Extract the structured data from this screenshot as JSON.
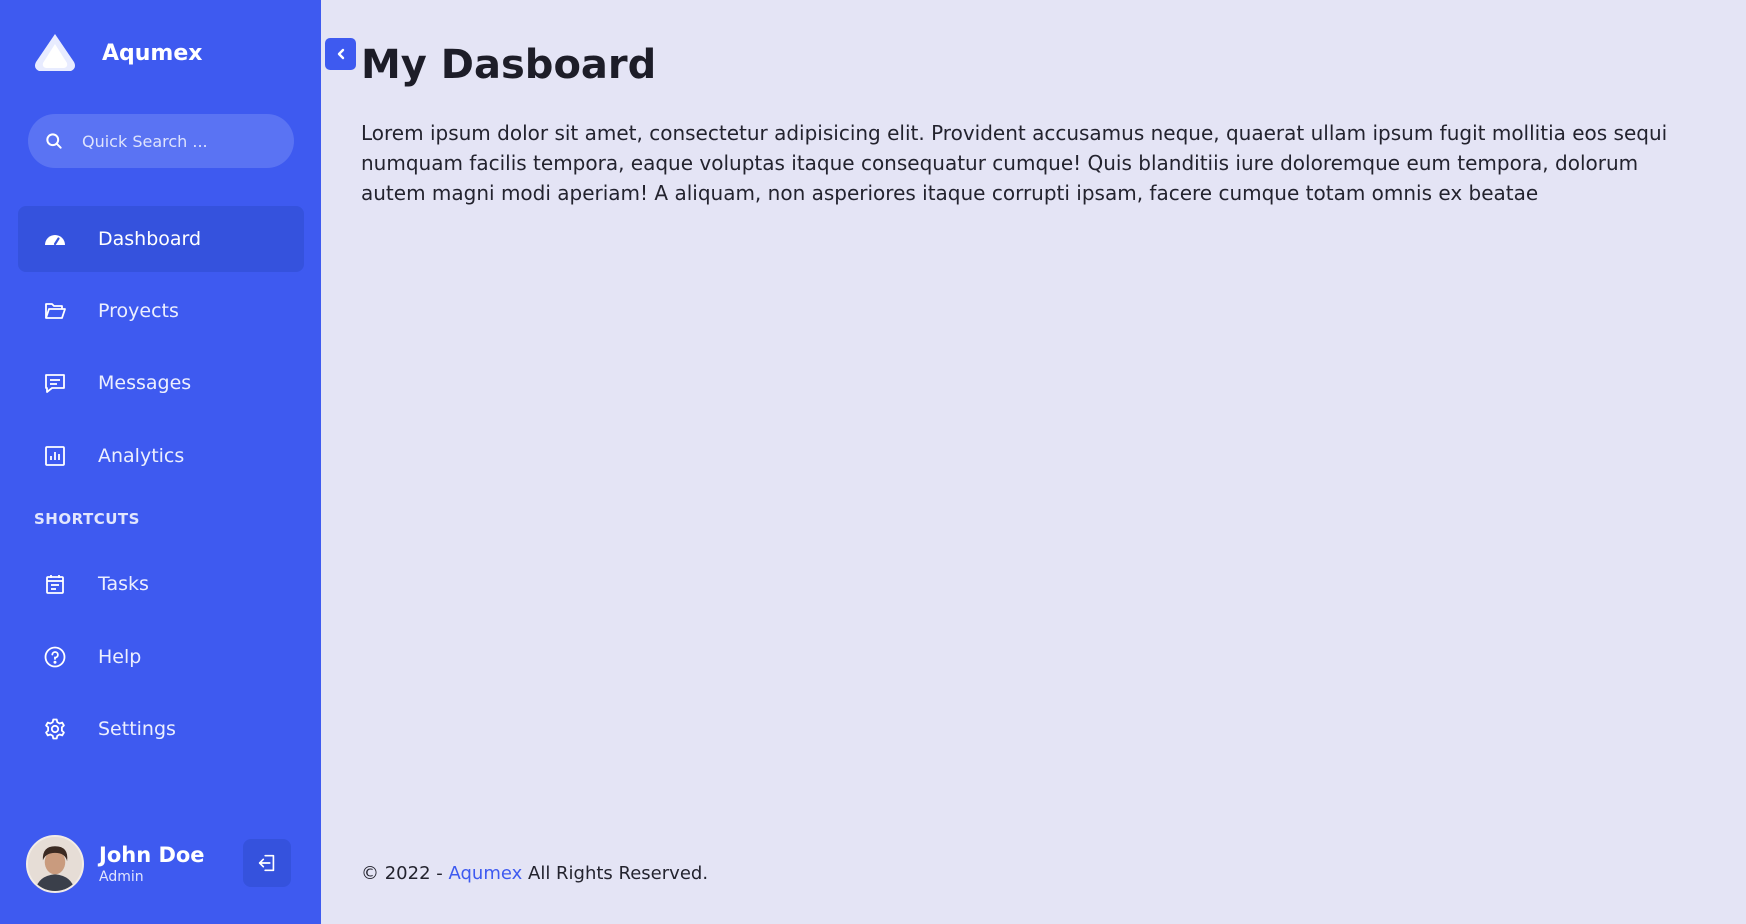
{
  "sidebar": {
    "brand": "Aqumex",
    "search_placeholder": "Quick Search ...",
    "nav": [
      {
        "label": "Dashboard",
        "icon": "dashboard-gauge-icon",
        "active": true
      },
      {
        "label": "Proyects",
        "icon": "folder-open-icon",
        "active": false
      },
      {
        "label": "Messages",
        "icon": "message-icon",
        "active": false
      },
      {
        "label": "Analytics",
        "icon": "bar-chart-icon",
        "active": false
      }
    ],
    "section_title": "SHORTCUTS",
    "shortcuts": [
      {
        "label": "Tasks",
        "icon": "calendar-icon"
      },
      {
        "label": "Help",
        "icon": "help-circle-icon"
      },
      {
        "label": "Settings",
        "icon": "gear-icon"
      }
    ],
    "user": {
      "name": "John Doe",
      "role": "Admin"
    }
  },
  "main": {
    "title": "My Dasboard",
    "text": "Lorem ipsum dolor sit amet, consectetur adipisicing elit. Provident accusamus neque, quaerat ullam ipsum fugit mollitia eos sequi numquam facilis tempora, eaque voluptas itaque consequatur cumque! Quis blanditiis iure doloremque eum tempora, dolorum autem magni modi aperiam! A aliquam, non asperiores itaque corrupti ipsam, facere cumque totam omnis ex beatae"
  },
  "footer": {
    "prefix": "© 2022 -",
    "link": "Aqumex",
    "suffix": "All Rights Reserved."
  },
  "colors": {
    "sidebar": "#3e5af0",
    "active_item": "#3552dd",
    "background": "#e4e4f5",
    "accent": "#3e5af0"
  }
}
